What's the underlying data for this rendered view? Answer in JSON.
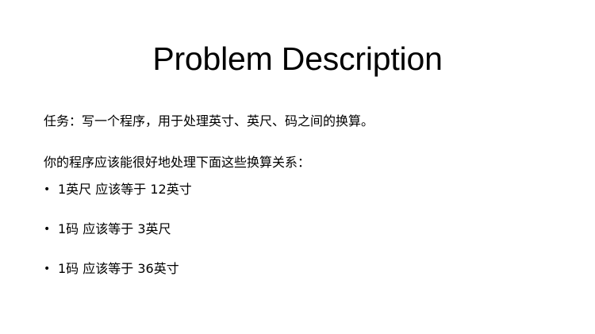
{
  "slide": {
    "title": "Problem Description",
    "task_text": "任务：写一个程序，用于处理英寸、英尺、码之间的换算。",
    "intro_text": "你的程序应该能很好地处理下面这些换算关系：",
    "bullets": [
      "1英尺 应该等于 12英寸",
      "1码 应该等于 3英尺",
      "1码 应该等于 36英寸"
    ],
    "bullet_symbol": "•"
  }
}
